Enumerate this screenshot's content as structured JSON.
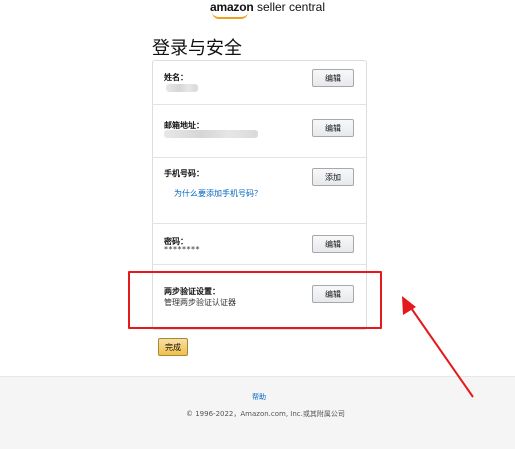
{
  "header": {
    "logo_bold": "amazon",
    "logo_rest": "seller central"
  },
  "page_title": "登录与安全",
  "sections": {
    "name": {
      "label": "姓名：",
      "button": "编辑"
    },
    "email": {
      "label": "邮箱地址：",
      "button": "编辑"
    },
    "phone": {
      "label": "手机号码：",
      "button": "添加",
      "link": "为什么要添加手机号码？"
    },
    "password": {
      "label": "密码：",
      "value": "********",
      "button": "编辑"
    },
    "two_step": {
      "label": "两步验证设置：",
      "description": "管理两步验证认证器",
      "button": "编辑"
    }
  },
  "done_button": "完成",
  "footer": {
    "help": "帮助",
    "copyright": "© 1996-2022，Amazon.com, Inc.或其附属公司"
  },
  "colors": {
    "highlight": "#e3191b",
    "link": "#0066c0",
    "done_button": "#f0c14b"
  }
}
